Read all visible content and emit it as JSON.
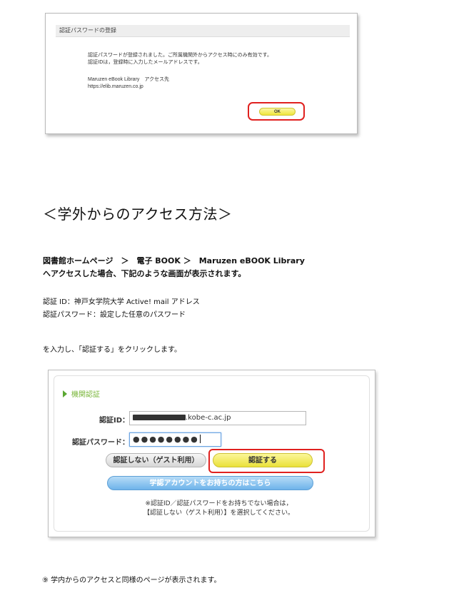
{
  "screenshot1": {
    "dialog_title": "認証パスワードの登録",
    "message_line1": "認証パスワードが登録されました。ご所属機関外からアクセス時にのみ有効です。",
    "message_line2": "認証IDは，登録時に入力したメールアドレスです。",
    "access_label": "Maruzen eBook Library　アクセス先",
    "access_url": "https://elib.maruzen.co.jp",
    "ok_button": "OK"
  },
  "heading": "＜学外からのアクセス方法＞",
  "para1": "図書館ホームページ　＞　電子 BOOK ＞　Maruzen eBOOK Library",
  "para2": "へアクセスした場合、下記のような画面が表示されます。",
  "para3": "認証 ID：神戸女学院大学 Active! mail アドレス",
  "para4": "認証パスワード：設定した任意のパスワード",
  "para5": "を入力し、「認証する」をクリックします。",
  "screenshot2": {
    "section_title": "機関認証",
    "id_label": "認証ID：",
    "id_value_suffix": ".kobe-c.ac.jp",
    "password_label": "認証パスワード：",
    "password_masked": "●●●●●●●●",
    "guest_button": "認証しない（ゲスト利用）",
    "auth_button": "認証する",
    "account_button": "学認アカウントをお持ちの方はこちら",
    "note_line1": "※認証ID／認証パスワードをお持ちでない場合は，",
    "note_line2": "【認証しない（ゲスト利用）】を選択してください。"
  },
  "footer_note": "⑨ 学内からのアクセスと同様のページが表示されます。",
  "colors": {
    "highlight_red": "#e0211f",
    "button_yellow": "#efe63b",
    "button_blue": "#6eb3ea",
    "section_green": "#7ab63a"
  }
}
